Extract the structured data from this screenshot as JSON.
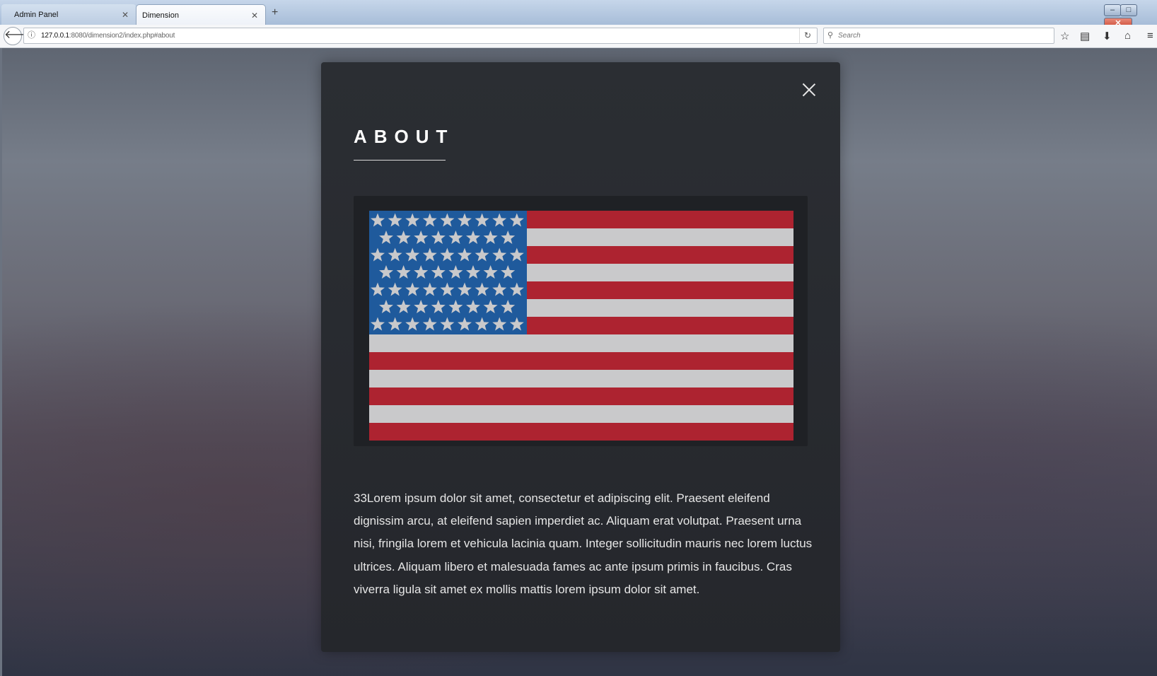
{
  "browser": {
    "tabs": [
      {
        "label": "Admin Panel",
        "active": false
      },
      {
        "label": "Dimension",
        "active": true
      }
    ],
    "url_host": "127.0.0.1",
    "url_path": ":8080/dimension2/index.php#about",
    "search_placeholder": "Search"
  },
  "modal": {
    "title": "ABOUT",
    "image": {
      "description_icon": "us-flag",
      "colors": {
        "blue": "#1f5a9c",
        "red": "#ad2330",
        "white": "#c9c9cb"
      }
    },
    "body": "33Lorem ipsum dolor sit amet, consectetur et adipiscing elit. Praesent eleifend dignissim arcu, at eleifend sapien imperdiet ac. Aliquam erat volutpat. Praesent urna nisi, fringila lorem et vehicula lacinia quam. Integer sollicitudin mauris nec lorem luctus ultrices. Aliquam libero et malesuada fames ac ante ipsum primis in faucibus. Cras viverra ligula sit amet ex mollis mattis lorem ipsum dolor sit amet."
  }
}
